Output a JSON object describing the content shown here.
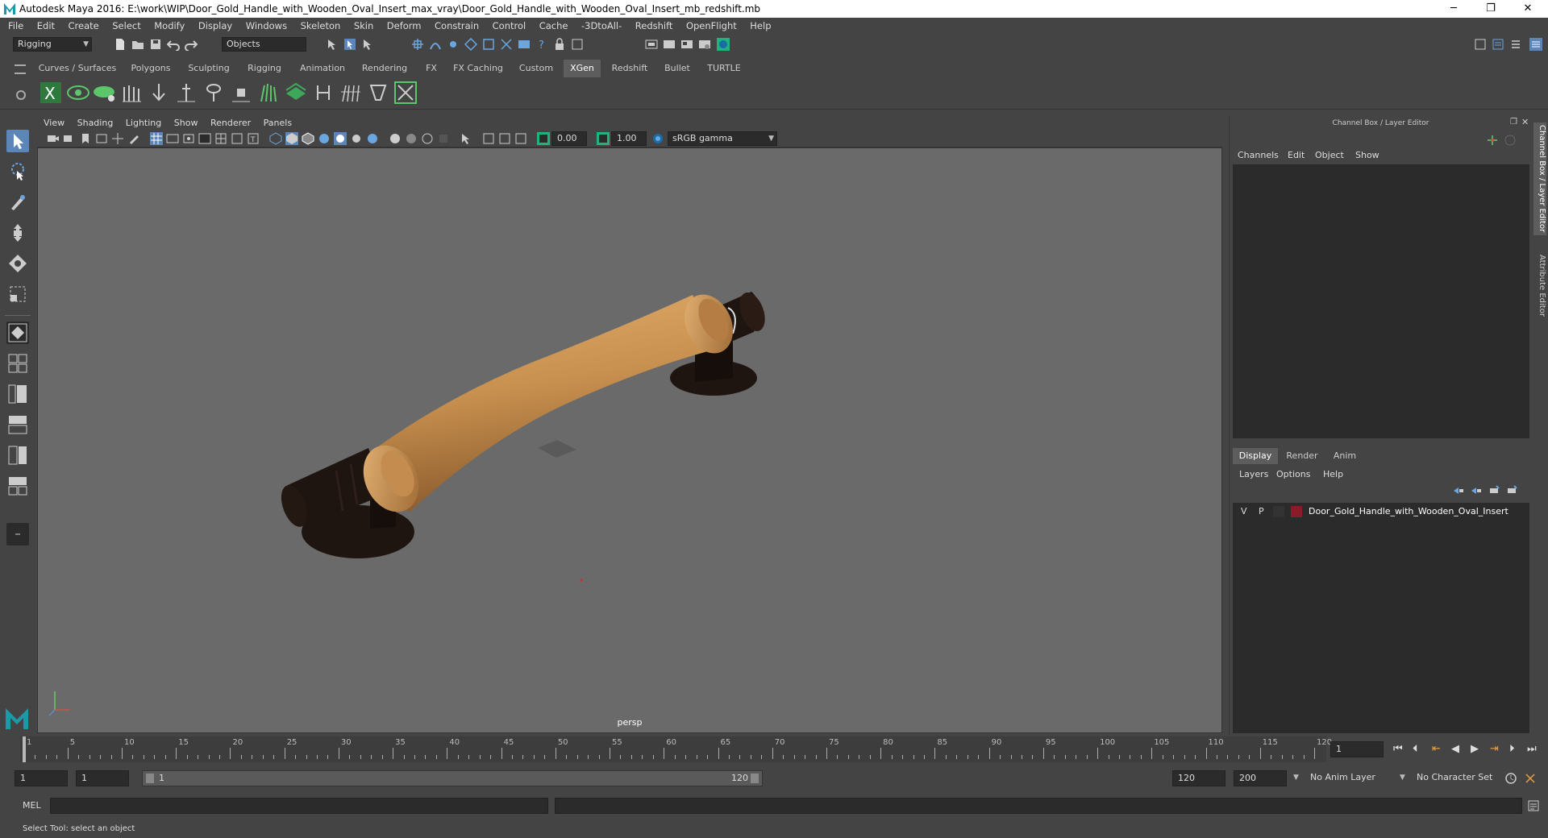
{
  "window": {
    "title": "Autodesk Maya 2016: E:\\work\\WIP\\Door_Gold_Handle_with_Wooden_Oval_Insert_max_vray\\Door_Gold_Handle_with_Wooden_Oval_Insert_mb_redshift.mb",
    "minimize": "─",
    "maximize": "❐",
    "close": "✕"
  },
  "menubar": [
    "File",
    "Edit",
    "Create",
    "Select",
    "Modify",
    "Display",
    "Windows",
    "Skeleton",
    "Skin",
    "Deform",
    "Constrain",
    "Control",
    "Cache",
    "-3DtoAll-",
    "Redshift",
    "OpenFlight",
    "Help"
  ],
  "status": {
    "mode": "Rigging",
    "objects": "Objects"
  },
  "shelf_tabs": [
    "Curves / Surfaces",
    "Polygons",
    "Sculpting",
    "Rigging",
    "Animation",
    "Rendering",
    "FX",
    "FX Caching",
    "Custom",
    "XGen",
    "Redshift",
    "Bullet",
    "TURTLE"
  ],
  "shelf_active": "XGen",
  "viewport_menu": [
    "View",
    "Shading",
    "Lighting",
    "Show",
    "Renderer",
    "Panels"
  ],
  "viewport_toolbar": {
    "exposure": "0.00",
    "gamma": "1.00",
    "colorspace": "sRGB gamma"
  },
  "viewport": {
    "camera": "persp"
  },
  "channel_box": {
    "title": "Channel Box / Layer Editor",
    "menus": [
      "Channels",
      "Edit",
      "Object",
      "Show"
    ]
  },
  "layer_editor": {
    "tabs": [
      "Display",
      "Render",
      "Anim"
    ],
    "active_tab": "Display",
    "menus": [
      "Layers",
      "Options",
      "Help"
    ],
    "layers": [
      {
        "v": "V",
        "p": "P",
        "color": "#8b1a2b",
        "name": "Door_Gold_Handle_with_Wooden_Oval_Insert"
      }
    ]
  },
  "side_tabs": [
    "Channel Box / Layer Editor",
    "Attribute Editor"
  ],
  "timeline": {
    "ticks": [
      "1",
      "5",
      "10",
      "15",
      "20",
      "25",
      "30",
      "35",
      "40",
      "45",
      "50",
      "55",
      "60",
      "65",
      "70",
      "75",
      "80",
      "85",
      "90",
      "95",
      "100",
      "105",
      "110",
      "115",
      "120"
    ],
    "current_frame": "1"
  },
  "range": {
    "start": "1",
    "anim_start": "1",
    "slider_start": "1",
    "slider_end": "120",
    "end": "120",
    "anim_end": "200",
    "anim_layer": "No Anim Layer",
    "char_set": "No Character Set"
  },
  "cmd": {
    "label": "MEL"
  },
  "help_line": "Select Tool: select an object",
  "colors": {
    "accent": "#1a9aa8",
    "wood": "#c8904f",
    "dark": "#1e1410",
    "viewport": "#6a6a6a"
  }
}
